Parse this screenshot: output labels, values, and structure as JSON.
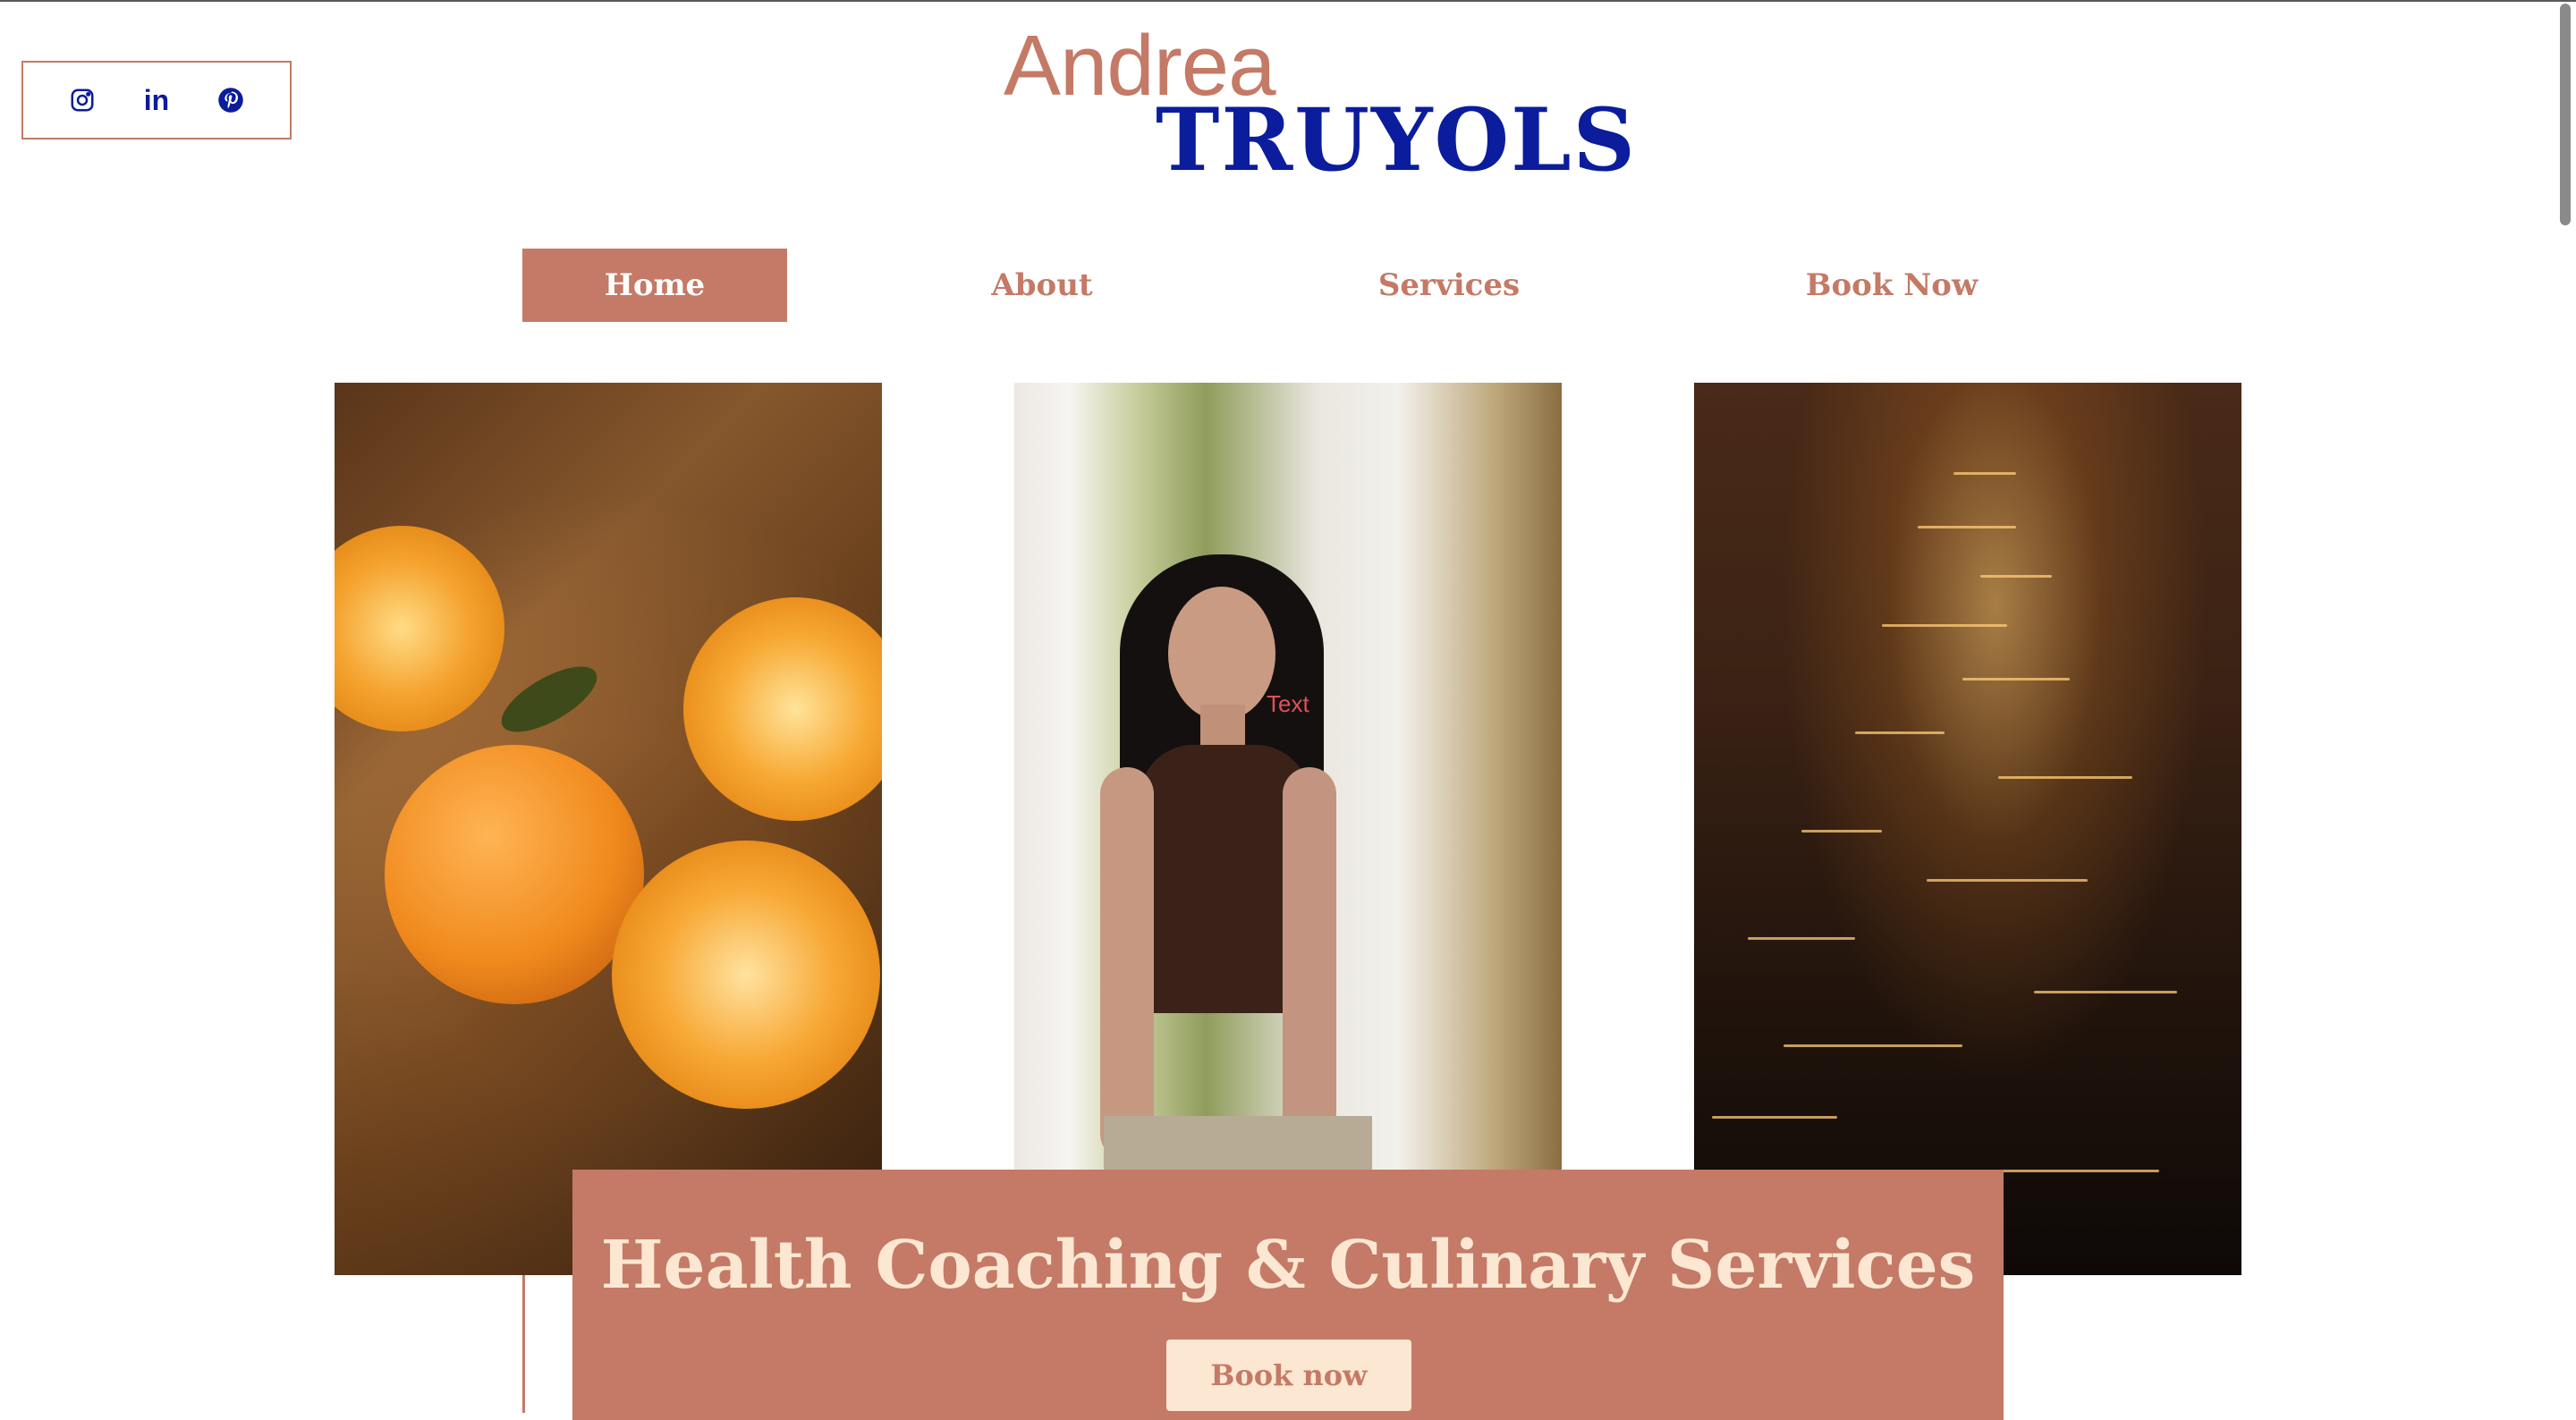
{
  "social": {
    "icons": [
      "instagram-icon",
      "linkedin-icon",
      "pinterest-icon"
    ],
    "linkedin_glyph": "in"
  },
  "logo": {
    "first": "Andrea",
    "last": "TRUYOLS"
  },
  "nav": {
    "items": [
      "Home",
      "About",
      "Services",
      "Book Now"
    ],
    "active": "Home"
  },
  "photos": {
    "portrait_overlay": "Text"
  },
  "hero": {
    "title": "Health Coaching & Culinary Services",
    "button": "Book now"
  },
  "colors": {
    "accent": "#c47a66",
    "brand_blue": "#0b1c9c",
    "cream": "#fbe7d2"
  }
}
